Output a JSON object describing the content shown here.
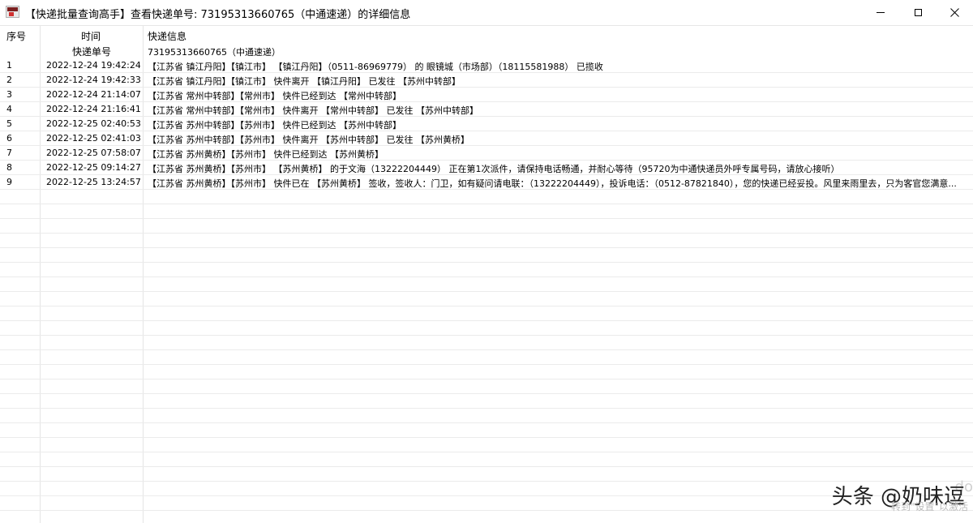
{
  "window": {
    "title": "【快递批量查询高手】查看快递单号: 73195313660765（中通速递）的详细信息"
  },
  "table": {
    "headers": {
      "idx": "序号",
      "time": "时间",
      "info": "快递信息",
      "sub_time": "快递单号",
      "sub_info": "73195313660765（中通速递）"
    },
    "rows": [
      {
        "idx": "1",
        "time": "2022-12-24 19:42:24",
        "info": "【江苏省 镇江丹阳】【镇江市】 【镇江丹阳】（0511-86969779） 的 眼镜城（市场部）（18115581988） 已揽收"
      },
      {
        "idx": "2",
        "time": "2022-12-24 19:42:33",
        "info": "【江苏省 镇江丹阳】【镇江市】 快件离开 【镇江丹阳】 已发往 【苏州中转部】"
      },
      {
        "idx": "3",
        "time": "2022-12-24 21:14:07",
        "info": "【江苏省 常州中转部】【常州市】 快件已经到达 【常州中转部】"
      },
      {
        "idx": "4",
        "time": "2022-12-24 21:16:41",
        "info": "【江苏省 常州中转部】【常州市】 快件离开 【常州中转部】 已发往 【苏州中转部】"
      },
      {
        "idx": "5",
        "time": "2022-12-25 02:40:53",
        "info": "【江苏省 苏州中转部】【苏州市】 快件已经到达 【苏州中转部】"
      },
      {
        "idx": "6",
        "time": "2022-12-25 02:41:03",
        "info": "【江苏省 苏州中转部】【苏州市】 快件离开 【苏州中转部】 已发往 【苏州黄桥】"
      },
      {
        "idx": "7",
        "time": "2022-12-25 07:58:07",
        "info": "【江苏省 苏州黄桥】【苏州市】 快件已经到达 【苏州黄桥】"
      },
      {
        "idx": "8",
        "time": "2022-12-25 09:14:27",
        "info": "【江苏省 苏州黄桥】【苏州市】 【苏州黄桥】 的于文海（13222204449） 正在第1次派件，请保持电话畅通，并耐心等待（95720为中通快递员外呼专属号码，请放心接听）"
      },
      {
        "idx": "9",
        "time": "2022-12-25 13:24:57",
        "info": "【江苏省 苏州黄桥】【苏州市】 快件已在 【苏州黄桥】 签收，签收人：门卫，如有疑问请电联：（13222204449），投诉电话：（0512-87821840），您的快递已经妥投。风里来雨里去，只为客官您满意..."
      }
    ]
  },
  "watermark": {
    "text": "头条 @奶味逗",
    "faint_text": "转到\"设置\"以激活",
    "faint_text2": "do"
  }
}
